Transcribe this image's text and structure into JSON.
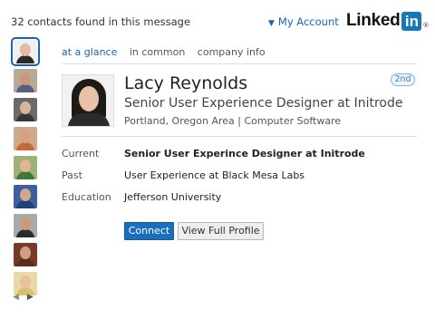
{
  "header": {
    "contacts_found": "32 contacts found in this message",
    "account_menu": "My Account",
    "logo_text": "Linked",
    "logo_box_text": "in",
    "logo_mark": "®"
  },
  "avatars": [
    {
      "face": "#e2bba0",
      "body": "#2a2a2a",
      "bg": "#f0f0f0"
    },
    {
      "face": "#c9977a",
      "body": "#55607a",
      "bg": "#b8a999"
    },
    {
      "face": "#d8b49a",
      "body": "#3a3530",
      "bg": "#6a6a6a"
    },
    {
      "face": "#d6a27e",
      "body": "#c46a3a",
      "bg": "#cfa98c"
    },
    {
      "face": "#e0b592",
      "body": "#3d7a3a",
      "bg": "#9fb07a"
    },
    {
      "face": "#d2a689",
      "body": "#1d3f7a",
      "bg": "#3d5f9e"
    },
    {
      "face": "#c99a7c",
      "body": "#2b2b2b",
      "bg": "#a9a9a9"
    },
    {
      "face": "#cf9f80",
      "body": "#5a2e1f",
      "bg": "#7a3a2a"
    },
    {
      "face": "#e6c29f",
      "body": "#d8c070",
      "bg": "#e9d8a8"
    }
  ],
  "pager": {
    "prev_icon": "◀",
    "next_icon": "▶"
  },
  "tabs": [
    {
      "label": "at a glance",
      "active": true
    },
    {
      "label": "in common",
      "active": false
    },
    {
      "label": "company info",
      "active": false
    }
  ],
  "profile": {
    "name": "Lacy Reynolds",
    "headline": "Senior User Experience Designer at Initrode",
    "location": "Portland, Oregon Area | Computer Software",
    "degree": "2nd"
  },
  "details": {
    "current_label": "Current",
    "current_value": "Senior User Experince Designer at Initrode",
    "past_label": "Past",
    "past_value": "User Experience at Black Mesa Labs",
    "education_label": "Education",
    "education_value": "Jefferson University"
  },
  "actions": {
    "connect": "Connect",
    "view_profile": "View Full Profile"
  },
  "colors": {
    "accent": "#1a64b0",
    "connect_button": "#1a6fbd",
    "logo_box": "#1a77b5"
  }
}
